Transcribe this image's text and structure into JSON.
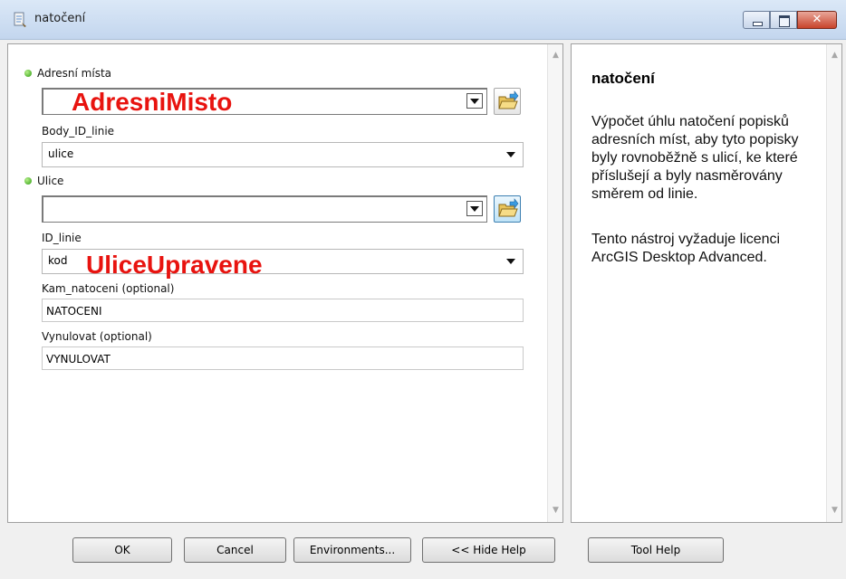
{
  "window": {
    "title": "natočení",
    "icon": "tool-script-icon"
  },
  "form": {
    "field1": {
      "label": "Adresní místa",
      "required": true,
      "value": ""
    },
    "field2": {
      "label": "Body_ID_linie",
      "value": "ulice"
    },
    "field3": {
      "label": "Ulice",
      "required": true,
      "value": ""
    },
    "field4": {
      "label": "ID_linie",
      "value": "kod"
    },
    "field5": {
      "label": "Kam_natoceni (optional)",
      "value": "NATOCENI"
    },
    "field6": {
      "label": "Vynulovat (optional)",
      "value": "VYNULOVAT"
    },
    "overlay1": "AdresniMisto",
    "overlay2": "UliceUpravene"
  },
  "help": {
    "title": "natočení",
    "paragraph1": "Výpočet úhlu natočení popisků adresních míst, aby tyto popisky byly rovnoběžně s ulicí, ke které příslušejí a byly nasměrovány směrem od linie.",
    "paragraph2": "Tento nástroj vyžaduje licenci ArcGIS Desktop Advanced."
  },
  "buttons": {
    "ok": "OK",
    "cancel": "Cancel",
    "environments": "Environments...",
    "hide_help": "<< Hide Help",
    "tool_help": "Tool Help"
  },
  "colors": {
    "overlay_text": "#e8130f",
    "required_dot": "#2c9b0f",
    "titlebar": "#c3d6ee"
  }
}
